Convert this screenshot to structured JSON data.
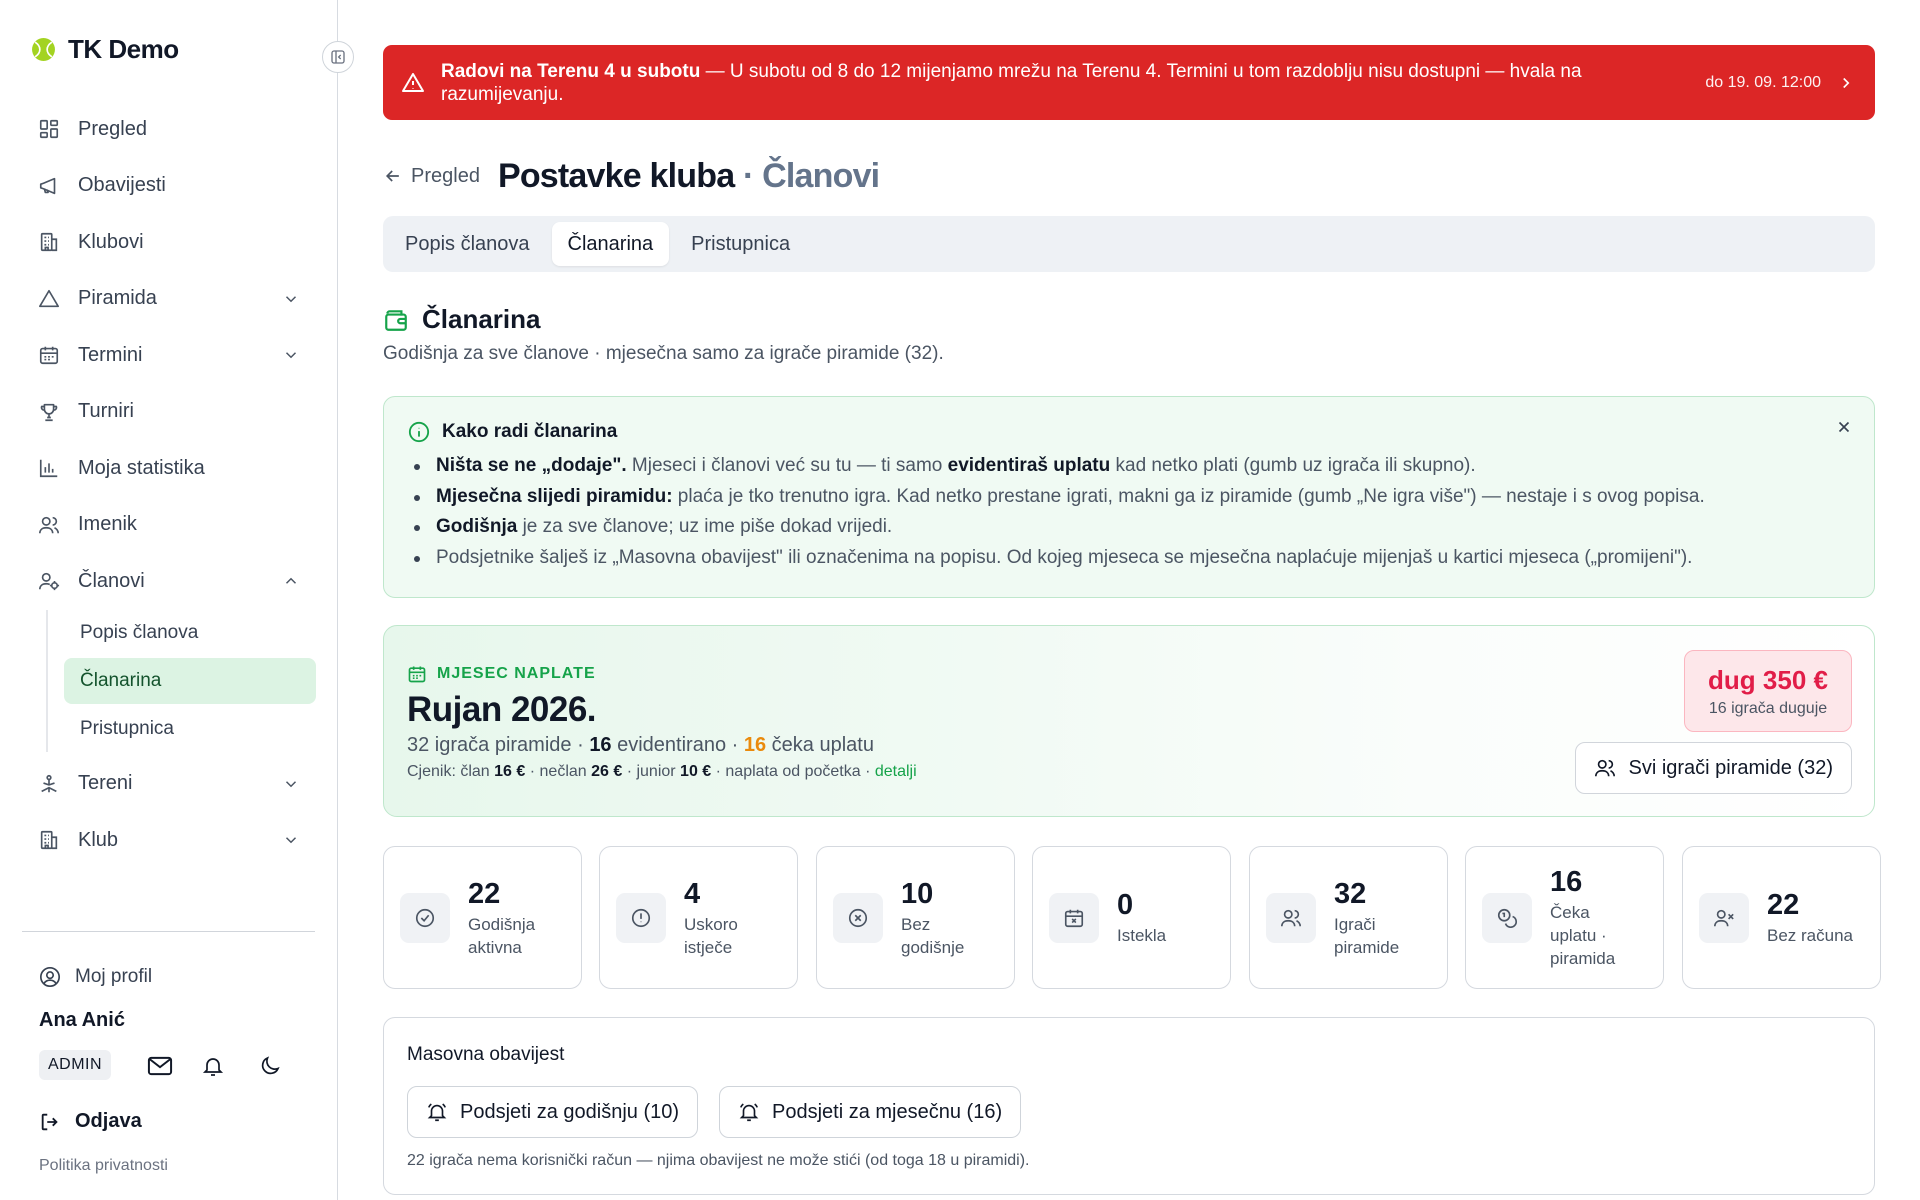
{
  "app": {
    "brand": "TK Demo"
  },
  "sidebar": {
    "items": [
      {
        "label": "Pregled",
        "icon": "dashboard-icon"
      },
      {
        "label": "Obavijesti",
        "icon": "megaphone-icon"
      },
      {
        "label": "Klubovi",
        "icon": "building-icon"
      },
      {
        "label": "Piramida",
        "icon": "triangle-icon",
        "expandable": true
      },
      {
        "label": "Termini",
        "icon": "calendar-icon",
        "expandable": true
      },
      {
        "label": "Turniri",
        "icon": "trophy-icon"
      },
      {
        "label": "Moja statistika",
        "icon": "bar-chart-icon"
      },
      {
        "label": "Imenik",
        "icon": "users-icon"
      },
      {
        "label": "Članovi",
        "icon": "user-cog-icon",
        "expanded": true
      },
      {
        "label": "Tereni",
        "icon": "court-icon",
        "expandable": true
      },
      {
        "label": "Klub",
        "icon": "building-icon",
        "expandable": true
      }
    ],
    "sub_items": [
      {
        "label": "Popis članova"
      },
      {
        "label": "Članarina",
        "active": true
      },
      {
        "label": "Pristupnica"
      }
    ],
    "profile_link": "Moj profil",
    "user_name": "Ana Anić",
    "role_badge": "ADMIN",
    "logout": "Odjava",
    "privacy": "Politika privatnosti"
  },
  "alert": {
    "title": "Radovi na Terenu 4 u subotu",
    "message": " — U subotu od 8 do 12 mijenjamo mrežu na Terenu 4. Termini u tom razdoblju nisu dostupni — hvala na razumijevanju.",
    "until": "do 19. 09. 12:00"
  },
  "header": {
    "back_label": "Pregled",
    "title": "Postavke kluba",
    "title_sub": " · Članovi"
  },
  "tabs": [
    {
      "label": "Popis članova"
    },
    {
      "label": "Članarina",
      "active": true
    },
    {
      "label": "Pristupnica"
    }
  ],
  "section": {
    "title": "Članarina",
    "description": "Godišnja za sve članove · mjesečna samo za igrače piramide (32)."
  },
  "info": {
    "title": "Kako radi članarina",
    "b1_bold": "Ništa se ne „dodaje\".",
    "b1_text": " Mjeseci i članovi već su tu — ti samo ",
    "b1_bold2": "evidentiraš uplatu",
    "b1_text2": " kad netko plati (gumb uz igrača ili skupno).",
    "b2_bold": "Mjesečna slijedi piramidu:",
    "b2_text": " plaća je tko trenutno igra. Kad netko prestane igrati, makni ga iz piramide (gumb „Ne igra više\") — nestaje i s ovog popisa.",
    "b3_bold": "Godišnja",
    "b3_text": " je za sve članove; uz ime piše dokad vrijedi.",
    "b4_text": "Podsjetnike šalješ iz „Masovna obavijest\" ili označenima na popisu. Od kojeg mjeseca se mjesečna naplaćuje mijenjaš u kartici mjeseca („promijeni\")."
  },
  "month": {
    "label": "MJESEC NAPLATE",
    "title": "Rujan 2026.",
    "players_text": "32 igrača piramide · ",
    "recorded_count": "16",
    "recorded_text": " evidentirano · ",
    "waiting_count": "16",
    "waiting_text": " čeka uplatu",
    "price_prefix": "Cjenik: član ",
    "price_member": "16 €",
    "price_nonmember_label": " · nečlan ",
    "price_nonmember": "26 €",
    "price_junior_label": " · junior ",
    "price_junior": "10 €",
    "price_suffix": " · naplata od početka · ",
    "details_link": "detalji",
    "debt_amount": "dug 350 €",
    "debt_sub": "16 igrača duguje",
    "all_players_button": "Svi igrači piramide (32)"
  },
  "stats": [
    {
      "value": "22",
      "label": "Godišnja aktivna",
      "icon": "check-circle-icon"
    },
    {
      "value": "4",
      "label": "Uskoro istječe",
      "icon": "alert-circle-icon"
    },
    {
      "value": "10",
      "label": "Bez godišnje",
      "icon": "x-circle-icon"
    },
    {
      "value": "0",
      "label": "Istekla",
      "icon": "calendar-x-icon"
    },
    {
      "value": "32",
      "label": "Igrači piramide",
      "icon": "users-icon"
    },
    {
      "value": "16",
      "label": "Čeka uplatu · piramida",
      "icon": "coins-icon"
    },
    {
      "value": "22",
      "label": "Bez računa",
      "icon": "user-x-icon"
    }
  ],
  "mass": {
    "title": "Masovna obavijest",
    "btn_annual": "Podsjeti za godišnju (10)",
    "btn_monthly": "Podsjeti za mjesečnu (16)",
    "note": "22 igrača nema korisnički račun — njima obavijest ne može stići (od toga 18 u piramidi)."
  },
  "colors": {
    "alert": "#dc2626",
    "accent_green": "#16a34a",
    "debt": "#e11d48",
    "waiting": "#ea8a0c"
  }
}
